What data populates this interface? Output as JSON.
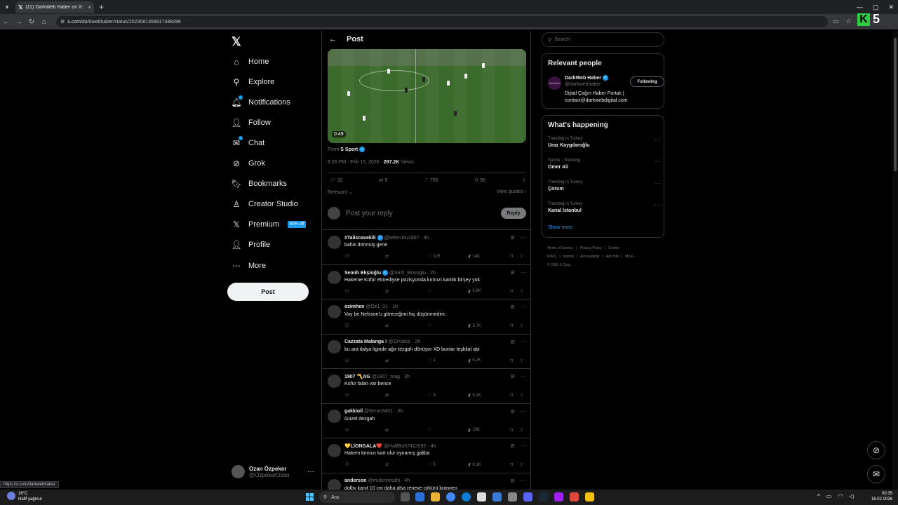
{
  "browser": {
    "tab_title": "(11) DarkWeb Haber on X: \"Ha",
    "tab_close": "×",
    "new_tab": "+",
    "url_domain": "x.com",
    "url_path": "/darkwebhaber/status/2023081359917388286",
    "status_url": "https://x.com/darkwebhaber",
    "window_controls": [
      "—",
      "▢",
      "✕"
    ]
  },
  "overlay": {
    "k_letter": "K",
    "number": "5"
  },
  "nav": {
    "logo": "𝕏",
    "items": [
      {
        "label": "Home",
        "icon": "home-icon",
        "glyph": "⌂"
      },
      {
        "label": "Explore",
        "icon": "search-icon",
        "glyph": "⚲"
      },
      {
        "label": "Notifications",
        "icon": "bell-icon",
        "glyph": "🔔︎"
      },
      {
        "label": "Follow",
        "icon": "person-add-icon",
        "glyph": "👤︎"
      },
      {
        "label": "Chat",
        "icon": "chat-icon",
        "glyph": "✉"
      },
      {
        "label": "Grok",
        "icon": "grok-icon",
        "glyph": "⊘"
      },
      {
        "label": "Bookmarks",
        "icon": "bookmark-icon",
        "glyph": "🔖︎"
      },
      {
        "label": "Creator Studio",
        "icon": "creator-studio-icon",
        "glyph": "♙"
      },
      {
        "label": "Premium",
        "icon": "x-premium-icon",
        "glyph": "𝕏"
      },
      {
        "label": "Profile",
        "icon": "profile-icon",
        "glyph": "👤︎"
      },
      {
        "label": "More",
        "icon": "more-circle-icon",
        "glyph": "⋯"
      }
    ],
    "premium_badge": "50% off",
    "post_button": "Post",
    "account": {
      "name": "Ozan Özpeker",
      "handle": "@OzpekerOzan",
      "more": "···"
    }
  },
  "post": {
    "header": "Post",
    "back": "←",
    "video_time": "0:49",
    "from_label": "From",
    "from_source": "S Sport",
    "time": "8:05 PM · Feb 15, 2026 ·",
    "views_count": "297.2K",
    "views_label": "Views",
    "stats": {
      "replies": "32",
      "reposts": "5",
      "likes": "765",
      "bookmarks": "96"
    },
    "sort_label": "Relevant",
    "view_quotes": "View quotes",
    "reply_placeholder": "Post your reply",
    "reply_button": "Reply"
  },
  "replies": [
    {
      "name": "#Taliscavekili",
      "verified": true,
      "handle": "@lefteruhu1907 · 4h",
      "text": "bahis dönmüş gene",
      "likes": "125",
      "views": "14K"
    },
    {
      "name": "Semih Ekşioğlu",
      "verified": true,
      "handle": "@Smh_Eksioglu · 2h",
      "text": "Hakeme Küfür etmediyse pozisyonda kırmızı kartlık birşey yok",
      "likes": "",
      "views": "5.9K"
    },
    {
      "name": "ozimhen",
      "verified": false,
      "handle": "@Oz1_01 · 1h",
      "text": "Vay be Nelsson'u göreceğimi hiç düşünmedim.",
      "likes": "",
      "views": "3.7K"
    },
    {
      "name": "Cazzata Malanga !",
      "verified": false,
      "handle": "@ZzValoz · 2h",
      "text": "bu ara italya ligindе ağır tezgah dönüyor XD bunlar teşkilat abi",
      "likes": "1",
      "views": "5.2K"
    },
    {
      "name": "1907 〽️AG",
      "verified": false,
      "handle": "@1907_mag · 3h",
      "text": "Küfür falan var bence",
      "likes": "9",
      "views": "9.1K"
    },
    {
      "name": "gakkioil",
      "verified": false,
      "handle": "@ferran3401 · 3h",
      "text": "Güzel dezgah",
      "likes": "",
      "views": "10K"
    },
    {
      "name": "💛LİONGALA❤️",
      "verified": false,
      "handle": "@HalilBo57412092 · 4h",
      "text": "Hakem kırmızı kart olur oynamış galiba",
      "likes": "5",
      "views": "8.1K"
    },
    {
      "name": "anderson",
      "verified": false,
      "handle": "@mutennroshi · 4h",
      "text": "dolby kanıt 10 cm daha alsa reneye çirkürü kranneо",
      "likes": "",
      "views": ""
    }
  ],
  "sidebar": {
    "search_placeholder": "Search",
    "relevant_title": "Relevant people",
    "person": {
      "name": "DarkWeb Haber",
      "handle": "@darkwebhaber",
      "bio": "Dijital Çağın Haber Portalı | contact@darkwebdigital.com",
      "button": "Following",
      "avatar_text": "DarkWeb"
    },
    "happening_title": "What's happening",
    "trends": [
      {
        "context": "Trending in Turkey",
        "title": "Uraz Kaygılaroğlu"
      },
      {
        "context": "Sports · Trending",
        "title": "Ömer Ali"
      },
      {
        "context": "Trending in Turkey",
        "title": "Çorum"
      },
      {
        "context": "Trending in Turkey",
        "title": "Kanal İstanbul"
      }
    ],
    "show_more": "Show more",
    "footer_links": [
      "Terms of Service",
      "|",
      "Privacy Policy",
      "|",
      "Cookie Policy",
      "|",
      "Imprint",
      "|",
      "Accessibility",
      "|",
      "Ads info",
      "|",
      "More ···"
    ],
    "copyright": "© 2026 X Corp."
  },
  "taskbar": {
    "temp": "16°C",
    "weather": "Hafif yağmur",
    "search": "Ara",
    "time": "00:35",
    "date": "16.02.2026"
  }
}
